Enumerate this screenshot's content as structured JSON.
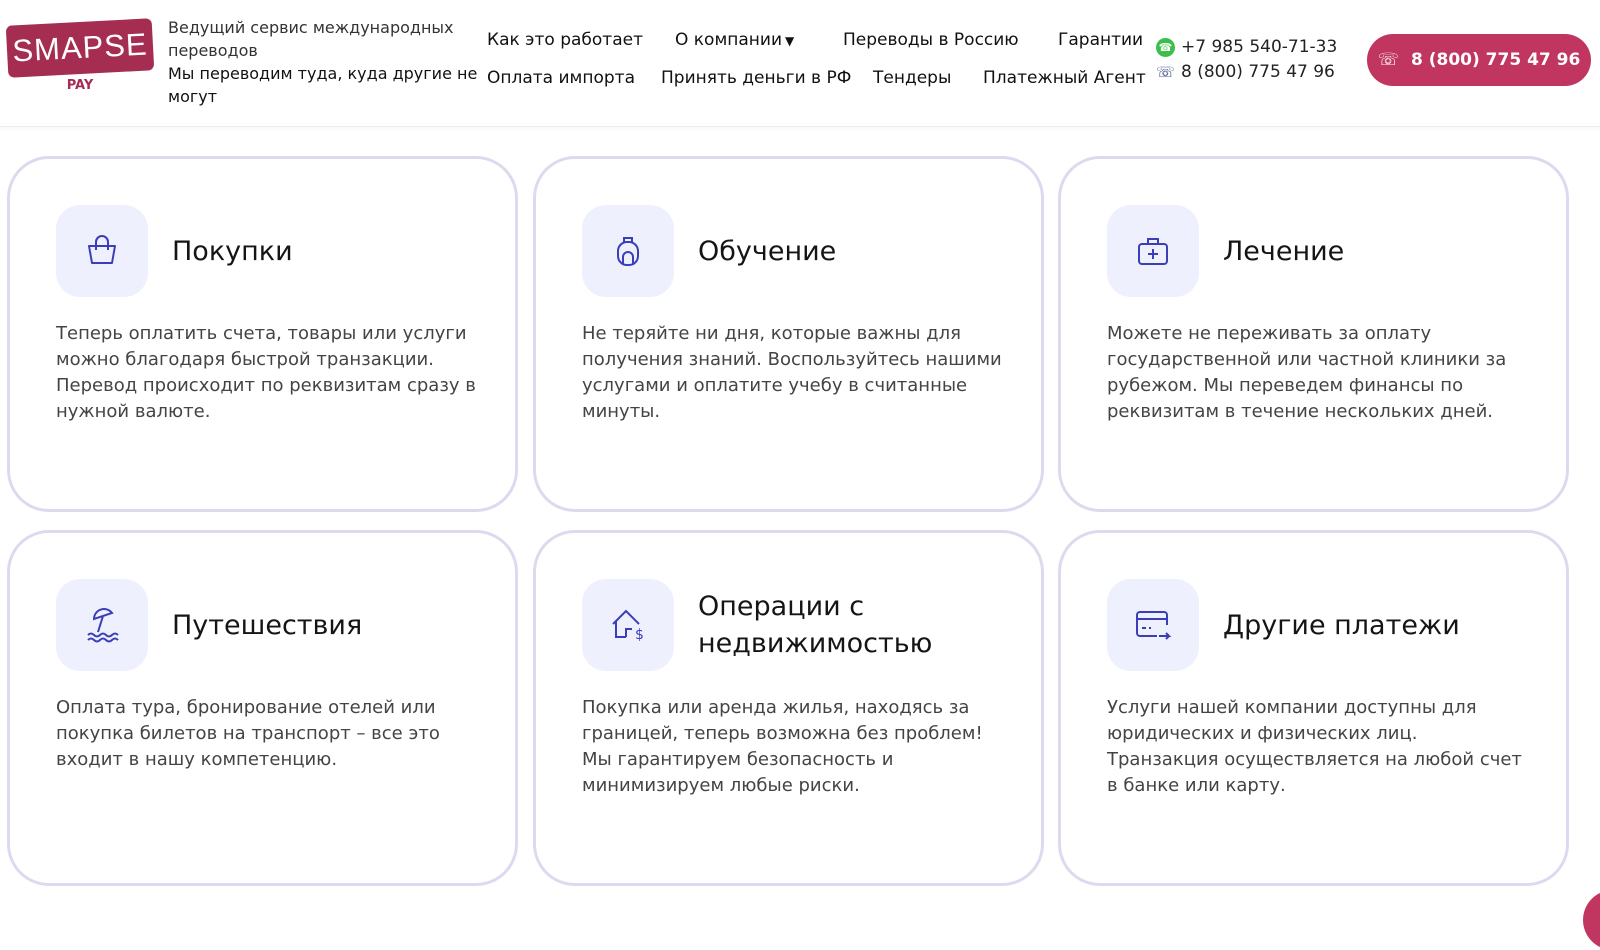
{
  "header": {
    "logo": {
      "name": "SMAPSE",
      "sub": "PAY"
    },
    "tagline": "Ведущий сервис международных переводов",
    "slogan": "Мы переводим туда, куда другие не могут",
    "nav": [
      "Как это работает",
      "О компании",
      "Переводы в Россию",
      "Гарантии",
      "Оплата импорта",
      "Принять деньги в РФ",
      "Тендеры",
      "Платежный Агент"
    ],
    "whatsapp": "+7 985 540-71-33",
    "phone": "8 (800) 775 47 96",
    "call_button": "8 (800) 775 47 96"
  },
  "cards": [
    {
      "title": "Покупки",
      "text": "Теперь оплатить счета, товары или услуги можно благодаря быстрой транзакции. Перевод происходит по реквизитам сразу в нужной валюте.",
      "icon": "shopping-bag-icon"
    },
    {
      "title": "Обучение",
      "text": "Не теряйте ни дня, которые важны для получения знаний. Воспользуйтесь нашими услугами и оплатите учебу в считанные минуты.",
      "icon": "backpack-icon"
    },
    {
      "title": "Лечение",
      "text": "Можете не переживать за оплату государственной или частной клиники за рубежом. Мы переведем финансы по реквизитам в течение нескольких дней.",
      "icon": "medical-kit-icon"
    },
    {
      "title": "Путешествия",
      "text": "Оплата тура, бронирование отелей или покупка билетов на транспорт – все это входит в нашу компетенцию.",
      "icon": "beach-umbrella-icon"
    },
    {
      "title": "Операции с недвижимостью",
      "text": "Покупка или аренда жилья, находясь за границей, теперь возможна без проблем! Мы гарантируем безопасность и минимизируем любые риски.",
      "icon": "house-dollar-icon"
    },
    {
      "title": "Другие платежи",
      "text": "Услуги нашей компании доступны для юридических и физических лиц. Транзакция осуществляется на любой счет в банке или карту.",
      "icon": "card-transfer-icon"
    }
  ],
  "colors": {
    "brand": "#a62d52",
    "button": "#c03660",
    "icon": "#3a3fb8",
    "icon_bg": "#eef0fd",
    "card_border": "#dddaf0"
  }
}
